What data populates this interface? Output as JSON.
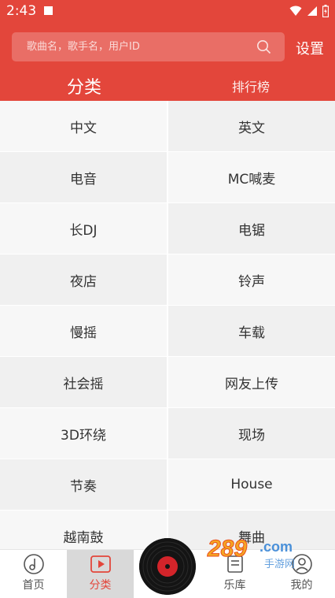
{
  "status_bar": {
    "time": "2:43"
  },
  "header": {
    "search_placeholder": "歌曲名，歌手名，用户ID",
    "settings_label": "设置",
    "tabs": [
      {
        "label": "分类",
        "active": true
      },
      {
        "label": "排行榜",
        "active": false
      }
    ]
  },
  "categories": [
    "中文",
    "英文",
    "电音",
    "MC喊麦",
    "长DJ",
    "电锯",
    "夜店",
    "铃声",
    "慢摇",
    "车载",
    "社会摇",
    "网友上传",
    "3D环绕",
    "现场",
    "节奏",
    "House",
    "越南鼓",
    "舞曲"
  ],
  "bottom_nav": [
    {
      "label": "首页",
      "icon": "music-note-icon",
      "active": false
    },
    {
      "label": "分类",
      "icon": "play-icon",
      "active": true
    },
    {
      "label": "乐库",
      "icon": "library-icon",
      "active": false
    },
    {
      "label": "我的",
      "icon": "user-icon",
      "active": false
    }
  ],
  "watermark": {
    "text": "289",
    "domain": ".com",
    "subtitle": "手游网"
  },
  "colors": {
    "accent": "#e3463b",
    "cell_light": "#f7f7f7",
    "cell_dark": "#f0f0f0"
  }
}
